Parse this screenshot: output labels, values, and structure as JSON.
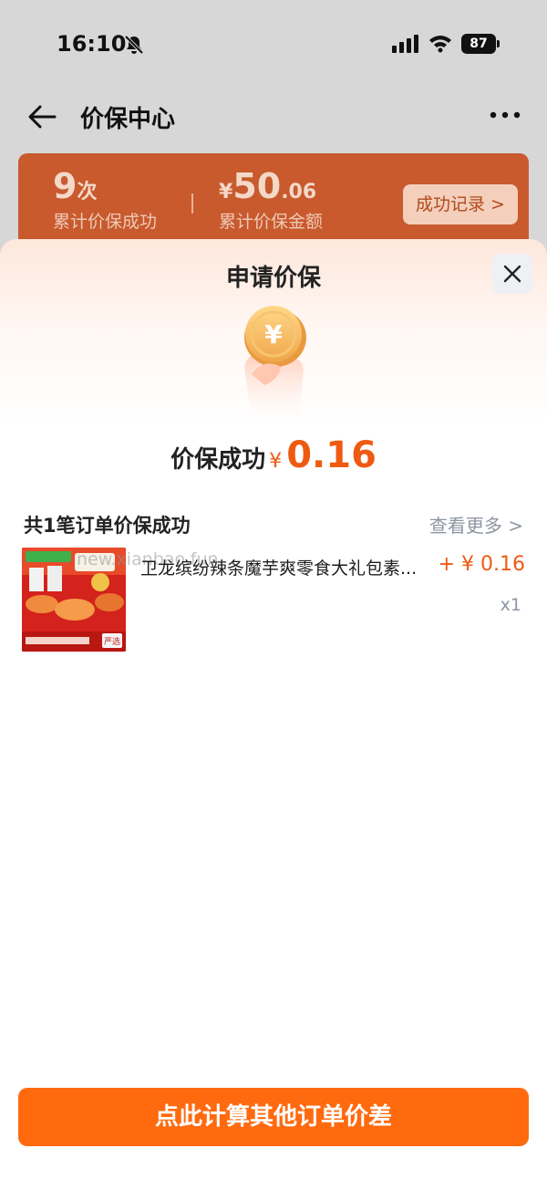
{
  "status_bar": {
    "time": "16:10",
    "battery": "87"
  },
  "nav": {
    "title": "价保中心"
  },
  "summary": {
    "count_value": "9",
    "count_unit": "次",
    "count_label": "累计价保成功",
    "amount_symbol": "¥",
    "amount_integer": "50",
    "amount_decimal": ".06",
    "amount_label": "累计价保金额",
    "records_button": "成功记录 >"
  },
  "sheet": {
    "title": "申请价保",
    "result_label": "价保成功",
    "result_symbol": "¥",
    "result_amount": "0.16",
    "section_title": "共1笔订单价保成功",
    "see_more": "查看更多 >",
    "order": {
      "product_title": "卫龙缤纷辣条魔芋爽零食大礼包素...",
      "refund": "+ ¥ 0.16",
      "quantity": "x1",
      "watermark": "new.xianbao.fun",
      "image_badge": "严选"
    },
    "calc_button": "点此计算其他订单价差"
  },
  "colors": {
    "accent": "#ff6a0f",
    "price": "#ef5a12",
    "summary_bg": "#c85a2e"
  }
}
